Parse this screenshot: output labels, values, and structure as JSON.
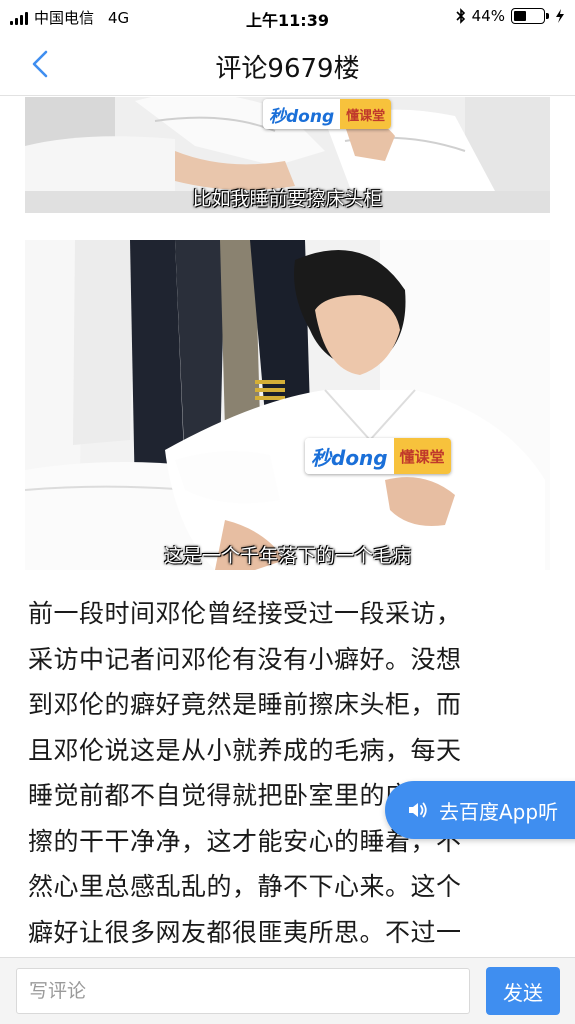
{
  "status_bar": {
    "carrier": "中国电信",
    "network": "4G",
    "time": "上午11:39",
    "battery_percent": 44,
    "battery_label": "44%",
    "icons": [
      "signal-icon",
      "bluetooth-icon",
      "battery-icon",
      "charging-bolt-icon"
    ]
  },
  "nav": {
    "back_icon": "chevron-left-icon",
    "title": "评论9679楼"
  },
  "images": [
    {
      "subtitle": "比如我睡前要擦床头柜",
      "badge": {
        "brand": "秒dong",
        "label": "懂课堂"
      }
    },
    {
      "subtitle": "这是一个千年落下的一个毛病",
      "badge": {
        "brand": "秒dong",
        "label": "懂课堂"
      }
    }
  ],
  "article": {
    "lines": [
      "前一段时间邓伦曾经接受过一段采访，",
      "采访中记者问邓伦有没有小癖好。没想",
      "到邓伦的癖好竟然是睡前擦床头柜，而",
      "且邓伦说这是从小就养成的毛病，每天",
      "睡觉前都不自觉得就把卧室里的床头柜",
      "擦的干干净净，这才能安心的睡着，不",
      "然心里总感乱乱的，静不下心来。这个",
      "癖好让很多网友都很匪夷所思。不过一"
    ]
  },
  "listen_button": {
    "icon": "speaker-icon",
    "label": "去百度App听"
  },
  "comment_bar": {
    "placeholder": "写评论",
    "value": "",
    "send_label": "发送"
  },
  "colors": {
    "accent": "#3f8ef0",
    "back_icon": "#3f8ef0",
    "text": "#1a1a1a"
  }
}
